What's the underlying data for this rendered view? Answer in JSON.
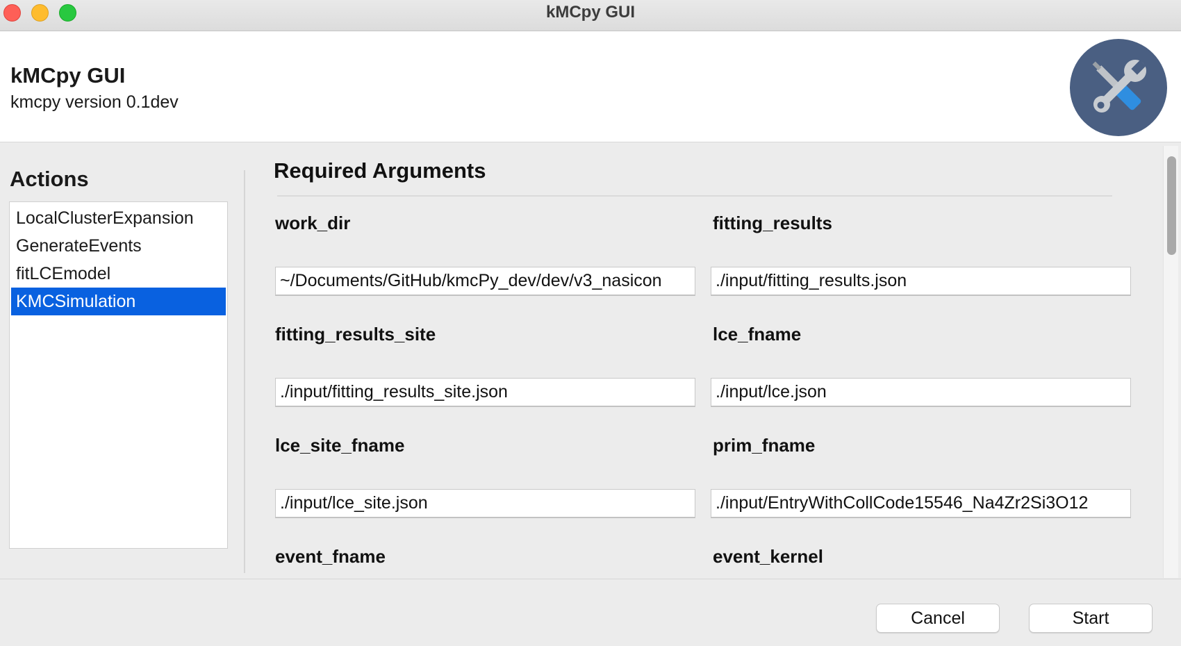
{
  "window": {
    "title": "kMCpy GUI"
  },
  "header": {
    "title": "kMCpy GUI",
    "version": "kmcpy version 0.1dev",
    "logo_icon": "wrench-screwdriver-icon",
    "logo_color": "#4a5f82"
  },
  "actions": {
    "heading": "Actions",
    "items": [
      {
        "label": "LocalClusterExpansion",
        "selected": false
      },
      {
        "label": "GenerateEvents",
        "selected": false
      },
      {
        "label": "fitLCEmodel",
        "selected": false
      },
      {
        "label": "KMCSimulation",
        "selected": true
      }
    ],
    "selected_color": "#0961e0"
  },
  "arguments": {
    "section_title": "Required Arguments",
    "fields": [
      {
        "label": "work_dir",
        "value": "~/Documents/GitHub/kmcPy_dev/dev/v3_nasicon"
      },
      {
        "label": "fitting_results",
        "value": "./input/fitting_results.json"
      },
      {
        "label": "fitting_results_site",
        "value": "./input/fitting_results_site.json"
      },
      {
        "label": "lce_fname",
        "value": "./input/lce.json"
      },
      {
        "label": "lce_site_fname",
        "value": "./input/lce_site.json"
      },
      {
        "label": "prim_fname",
        "value": "./input/EntryWithCollCode15546_Na4Zr2Si3O12"
      },
      {
        "label": "event_fname",
        "value": ""
      },
      {
        "label": "event_kernel",
        "value": ""
      }
    ]
  },
  "buttons": {
    "cancel": "Cancel",
    "start": "Start"
  }
}
